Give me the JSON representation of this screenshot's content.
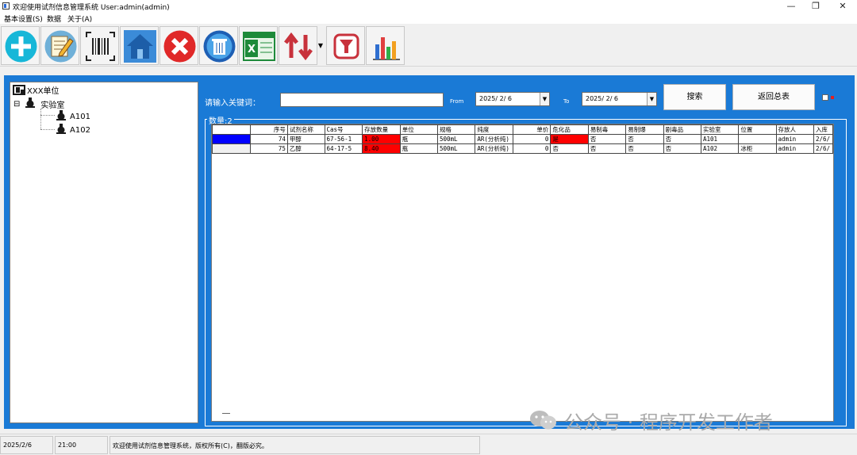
{
  "window": {
    "title": "欢迎使用试剂信息管理系统 User:admin(admin)",
    "controls": {
      "minimize": "—",
      "maximize": "❐",
      "close": "✕"
    }
  },
  "menu": [
    {
      "label": "基本设置(S)"
    },
    {
      "label": "数据"
    },
    {
      "label": "关于(A)"
    }
  ],
  "toolbar": [
    {
      "icon": "add-icon",
      "color": "#17b7d8"
    },
    {
      "icon": "edit-icon",
      "color": "#6fb0d8"
    },
    {
      "icon": "barcode-icon",
      "color": "#222222"
    },
    {
      "icon": "home-icon",
      "color": "#2a78c8"
    },
    {
      "icon": "delete-icon",
      "color": "#e02828"
    },
    {
      "icon": "trash-icon",
      "color": "#1e5fb4"
    },
    {
      "icon": "excel-icon",
      "color": "#1e8a3a"
    },
    {
      "icon": "sort-icon",
      "color": "#c8323c"
    },
    {
      "icon": "filter-icon",
      "color": "#c8323c"
    },
    {
      "icon": "chart-icon",
      "color": "#2f6fd0"
    }
  ],
  "tree": {
    "root": "XXX单位",
    "lab": "实验室",
    "rooms": [
      "A101",
      "A102"
    ],
    "expander": "⊟"
  },
  "search": {
    "keyword_label": "请输入关键词：",
    "keyword_value": "",
    "from_label": "From",
    "from_value": "2025/ 2/ 6",
    "to_label": "To",
    "to_value": "2025/ 2/ 6",
    "search_button": "搜索",
    "back_button": "返回总表"
  },
  "group": {
    "title": "数量:2"
  },
  "grid": {
    "columns": [
      "",
      "序号",
      "试剂名称",
      "Cas号",
      "存放数量",
      "单位",
      "规格",
      "纯度",
      "单价",
      "危化品",
      "易制毒",
      "易制爆",
      "剧毒品",
      "实验室",
      "位置",
      "存放人",
      "入库"
    ],
    "rows": [
      [
        "",
        "74",
        "甲醇",
        "67-56-1",
        "1.00",
        "瓶",
        "500mL",
        "AR(分析纯)",
        "0",
        "是",
        "否",
        "否",
        "否",
        "A101",
        "",
        "admin",
        "2/6/"
      ],
      [
        "",
        "75",
        "乙醇",
        "64-17-5",
        "8.40",
        "瓶",
        "500mL",
        "AR(分析纯)",
        "0",
        "否",
        "否",
        "否",
        "否",
        "A102",
        "冰柜",
        "admin",
        "2/6/"
      ]
    ]
  },
  "watermark": "公众号 · 程序开发工作者",
  "status": {
    "date": "2025/2/6",
    "time": "21:00",
    "message": "欢迎使用试剂信息管理系统，版权所有(C)，翻版必究。"
  },
  "colors": {
    "frame_blue": "#1a7ad6",
    "highlight_red": "#ff0000",
    "selected_blue": "#0000ff"
  }
}
